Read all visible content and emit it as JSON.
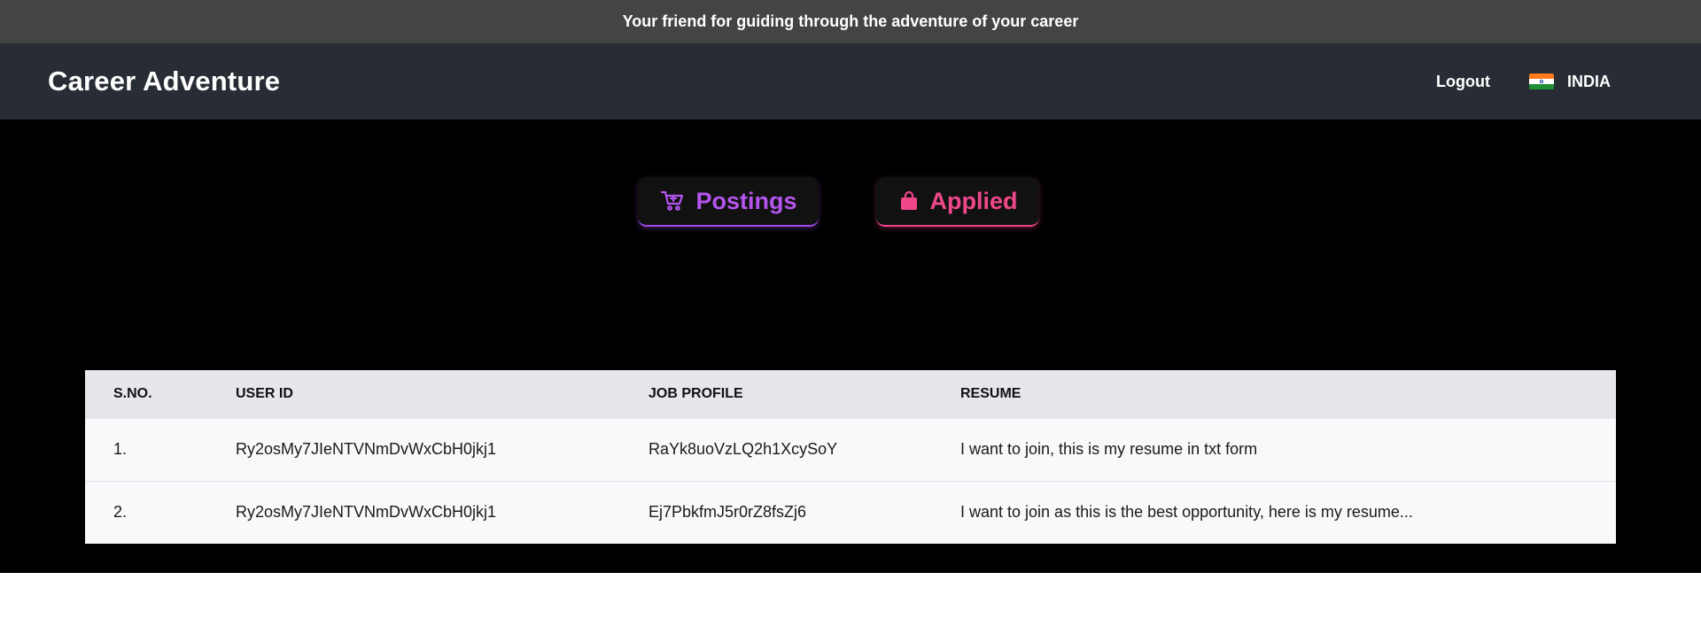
{
  "banner": {
    "text": "Your friend for guiding through the adventure of your career"
  },
  "navbar": {
    "brand": "Career Adventure",
    "logout_label": "Logout",
    "country": {
      "name": "INDIA",
      "flag_icon": "india-flag-icon"
    }
  },
  "tabs": [
    {
      "label": "Postings",
      "icon": "cart-icon",
      "color": "#b455ef"
    },
    {
      "label": "Applied",
      "icon": "shopping-bag-icon",
      "color": "#f0478b"
    }
  ],
  "table": {
    "headers": [
      "S.NO.",
      "USER ID",
      "JOB PROFILE",
      "RESUME"
    ],
    "rows": [
      {
        "sno": "1.",
        "user_id": "Ry2osMy7JIeNTVNmDvWxCbH0jkj1",
        "job_profile": "RaYk8uoVzLQ2h1XcySoY",
        "resume": "I want to join, this is my resume in txt form"
      },
      {
        "sno": "2.",
        "user_id": "Ry2osMy7JIeNTVNmDvWxCbH0jkj1",
        "job_profile": "Ej7PbkfmJ5r0rZ8fsZj6",
        "resume": "I want to join as this is the best opportunity, here is my resume..."
      }
    ]
  },
  "colors": {
    "banner_bg": "#434445",
    "navbar_bg": "#282c34",
    "main_bg": "#000000",
    "postings_accent": "#b455ef",
    "applied_accent": "#f0478b"
  }
}
